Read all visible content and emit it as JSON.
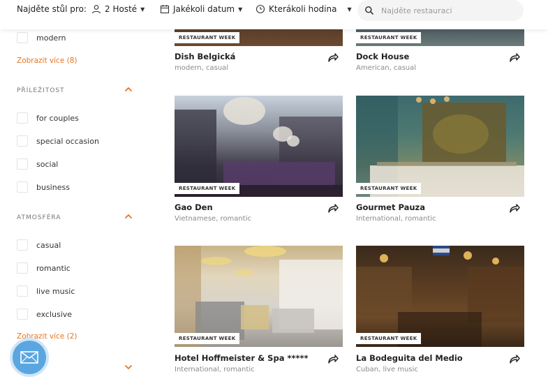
{
  "topbar": {
    "lead": "Najděte stůl pro:",
    "guests": "2 Hosté",
    "date": "Jakékoli datum",
    "time": "Kterákoli hodina",
    "search_placeholder": "Najděte restauraci"
  },
  "sidebar": {
    "top_item": "modern",
    "show_more_1": "Zobrazit více (8)",
    "section_1": "PŘÍLEŽITOST",
    "occasion": [
      "for couples",
      "special occasion",
      "social",
      "business"
    ],
    "section_2": "ATMOSFÉRA",
    "atmosphere": [
      "casual",
      "romantic",
      "live music",
      "exclusive"
    ],
    "show_more_2": "Zobrazit více (2)"
  },
  "badge_label": "RESTAURANT WEEK",
  "cards": [
    {
      "name": "Dish Belgická",
      "tags": "modern, casual"
    },
    {
      "name": "Dock House",
      "tags": "American, casual"
    },
    {
      "name": "Gao Den",
      "tags": "Vietnamese, romantic"
    },
    {
      "name": "Gourmet Pauza",
      "tags": "International, romantic"
    },
    {
      "name": "Hotel Hoffmeister & Spa *****",
      "tags": "International, romantic"
    },
    {
      "name": "La Bodeguita del Medio",
      "tags": "Cuban, live music"
    }
  ],
  "colors": {
    "accent": "#e8741e",
    "fab": "#5aa6e0"
  }
}
